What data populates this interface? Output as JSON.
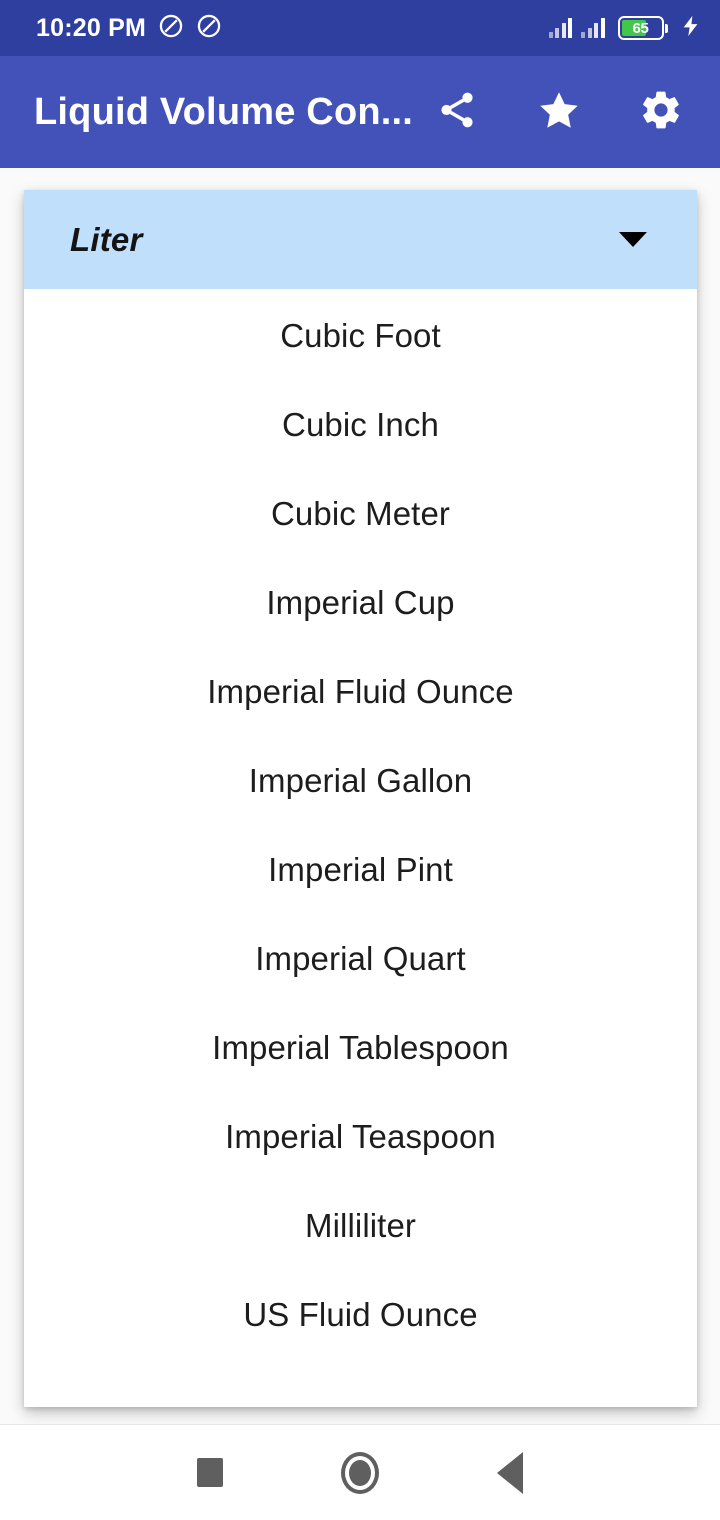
{
  "status_bar": {
    "clock": "10:20 PM",
    "icons": [
      "do-not-disturb-icon",
      "do-not-disturb-icon"
    ],
    "signal_1": "signal-bars-icon",
    "signal_2": "signal-bars-icon",
    "battery_level": "65",
    "charging": "charging-bolt-icon",
    "background_color": "#2f3fa0"
  },
  "app_bar": {
    "title": "Liquid Volume Con...",
    "background_color": "#4352b8",
    "actions": [
      {
        "name": "share-button",
        "icon": "share-icon"
      },
      {
        "name": "favorite-button",
        "icon": "star-icon"
      },
      {
        "name": "settings-button",
        "icon": "gear-icon"
      }
    ]
  },
  "dropdown": {
    "selected": "Liter",
    "expanded": true,
    "selected_background_color": "#bfdffa",
    "caret_icon": "chevron-down-icon",
    "options": [
      "Cubic Foot",
      "Cubic Inch",
      "Cubic Meter",
      "Imperial Cup",
      "Imperial Fluid Ounce",
      "Imperial Gallon",
      "Imperial Pint",
      "Imperial Quart",
      "Imperial Tablespoon",
      "Imperial Teaspoon",
      "Milliliter",
      "US Fluid Ounce"
    ]
  },
  "nav_bar": {
    "recents": "square-icon",
    "home": "circle-icon",
    "back": "triangle-left-icon"
  }
}
